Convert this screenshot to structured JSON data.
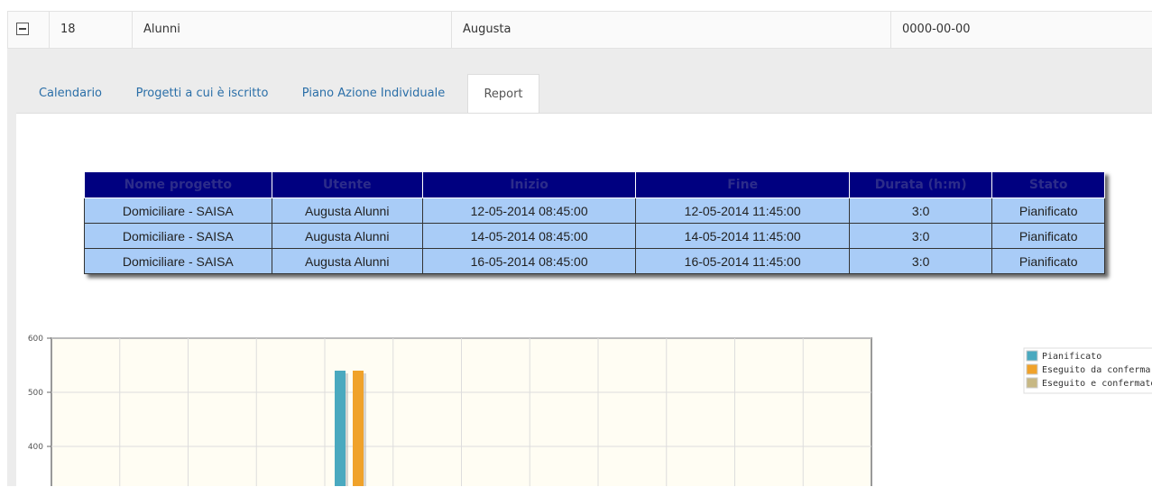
{
  "record": {
    "id": "18",
    "cognome": "Alunni",
    "nome": "Augusta",
    "data": "0000-00-00"
  },
  "tabs": [
    {
      "label": "Calendario"
    },
    {
      "label": "Progetti a cui è iscritto"
    },
    {
      "label": "Piano Azione Individuale"
    },
    {
      "label": "Report"
    }
  ],
  "table": {
    "headers": [
      "Nome progetto",
      "Utente",
      "Inizio",
      "Fine",
      "Durata (h:m)",
      "Stato"
    ],
    "rows": [
      [
        "Domiciliare - SAISA",
        "Augusta Alunni",
        "12-05-2014 08:45:00",
        "12-05-2014 11:45:00",
        "3:0",
        "Pianificato"
      ],
      [
        "Domiciliare - SAISA",
        "Augusta Alunni",
        "14-05-2014 08:45:00",
        "14-05-2014 11:45:00",
        "3:0",
        "Pianificato"
      ],
      [
        "Domiciliare - SAISA",
        "Augusta Alunni",
        "16-05-2014 08:45:00",
        "16-05-2014 11:45:00",
        "3:0",
        "Pianificato"
      ]
    ]
  },
  "chart_data": {
    "type": "bar",
    "yticks": [
      600,
      500,
      400
    ],
    "ylim": [
      300,
      600
    ],
    "gridlines_x": 12,
    "series": [
      {
        "name": "Pianificato",
        "color": "#4aa9bf",
        "value": 540
      },
      {
        "name": "Eseguito da confermare",
        "color": "#f0a22a",
        "value": 540
      },
      {
        "name": "Eseguito e confermato",
        "color": "#c7b884",
        "value": 0
      }
    ],
    "grid": true,
    "legend": "right"
  }
}
